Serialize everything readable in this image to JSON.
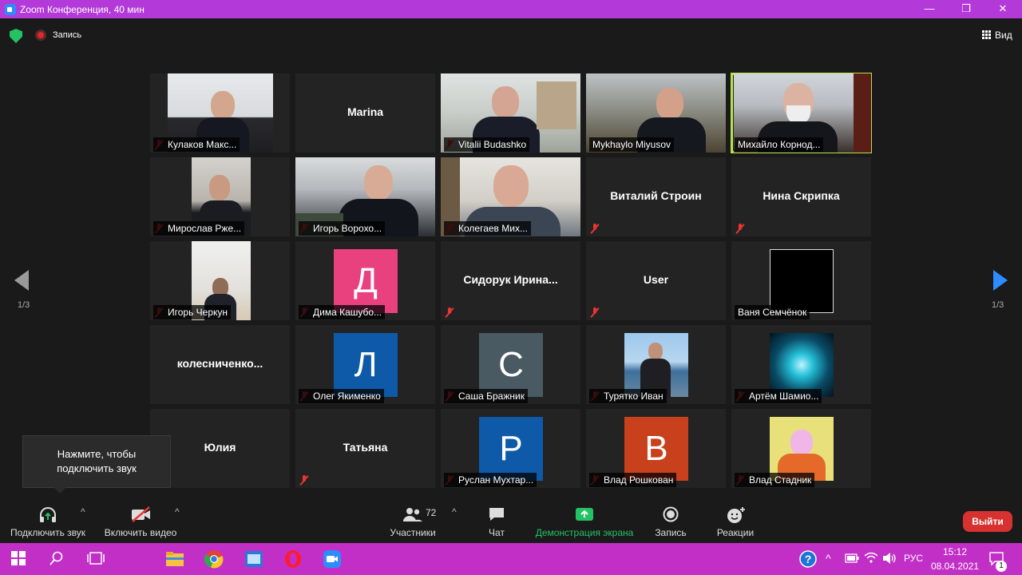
{
  "window": {
    "title": "Zoom Конференция, 40 мин",
    "controls": [
      "—",
      "❐",
      "✕"
    ]
  },
  "topbar": {
    "record_label": "Запись",
    "view_label": "Вид"
  },
  "pagination": {
    "left": "1/3",
    "right": "1/3"
  },
  "tiles": [
    {
      "name": "Кулаков Макс...",
      "kind": "photo",
      "muted": true
    },
    {
      "name": "Marina",
      "kind": "name",
      "muted": false
    },
    {
      "name": "Vitalii Budashko",
      "kind": "photo",
      "muted": true
    },
    {
      "name": "Mykhaylo Miyusov",
      "kind": "photo",
      "muted": false
    },
    {
      "name": "Михайло Корнод...",
      "kind": "photo",
      "muted": false,
      "active": true
    },
    {
      "name": "Мирослав Рже...",
      "kind": "photo",
      "muted": true
    },
    {
      "name": "Игорь Ворохо...",
      "kind": "photo",
      "muted": true
    },
    {
      "name": "Колегаев Мих...",
      "kind": "photo",
      "muted": true
    },
    {
      "name": "Виталий Строин",
      "kind": "name",
      "muted": true
    },
    {
      "name": "Нина Скрипка",
      "kind": "name",
      "muted": true
    },
    {
      "name": "Игорь Черкун",
      "kind": "photo",
      "muted": true
    },
    {
      "name": "Дима Кашубо...",
      "kind": "avatar",
      "letter": "Д",
      "color": "#e8417e",
      "muted": true
    },
    {
      "name": "Сидорук  Ирина...",
      "kind": "name",
      "muted": true
    },
    {
      "name": "User",
      "kind": "name",
      "muted": true
    },
    {
      "name": "Ваня Семчёнок",
      "kind": "black",
      "muted": false
    },
    {
      "name": "колесниченко...",
      "kind": "name",
      "muted": false
    },
    {
      "name": "Олег Якименко",
      "kind": "avatar",
      "letter": "Л",
      "color": "#0e5aa8",
      "muted": true
    },
    {
      "name": "Саша Бражник",
      "kind": "avatar",
      "letter": "С",
      "color": "#4a5a63",
      "muted": true
    },
    {
      "name": "Турятко Иван",
      "kind": "photo-small",
      "muted": true
    },
    {
      "name": "Артём Шамио...",
      "kind": "photo-small",
      "muted": true
    },
    {
      "name": "Юлия",
      "kind": "name",
      "muted": false
    },
    {
      "name": "Татьяна",
      "kind": "name",
      "muted": true
    },
    {
      "name": "Руслан Мухтар...",
      "kind": "avatar",
      "letter": "Р",
      "color": "#0e5aa8",
      "muted": true
    },
    {
      "name": "Влад Рошкован",
      "kind": "avatar",
      "letter": "В",
      "color": "#c8401c",
      "muted": true
    },
    {
      "name": "Влад Стадник",
      "kind": "photo-small",
      "muted": true
    }
  ],
  "tooltip": {
    "text_line1": "Нажмите, чтобы",
    "text_line2": "подключить звук"
  },
  "toolbar": {
    "audio": "Подключить звук",
    "video": "Включить видео",
    "participants": "Участники",
    "participants_count": "72",
    "chat": "Чат",
    "share": "Демонстрация экрана",
    "record": "Запись",
    "reactions": "Реакции",
    "leave": "Выйти"
  },
  "taskbar": {
    "lang": "РУС",
    "time": "15:12",
    "date": "08.04.2021",
    "notifications": "1"
  },
  "colors": {
    "accent": "#2d8cff",
    "title_bar": "#b33ad8",
    "taskbar": "#c12fc7",
    "active_speaker": "#b6e24c",
    "share_green": "#23c265",
    "leave_red": "#d7322f"
  }
}
